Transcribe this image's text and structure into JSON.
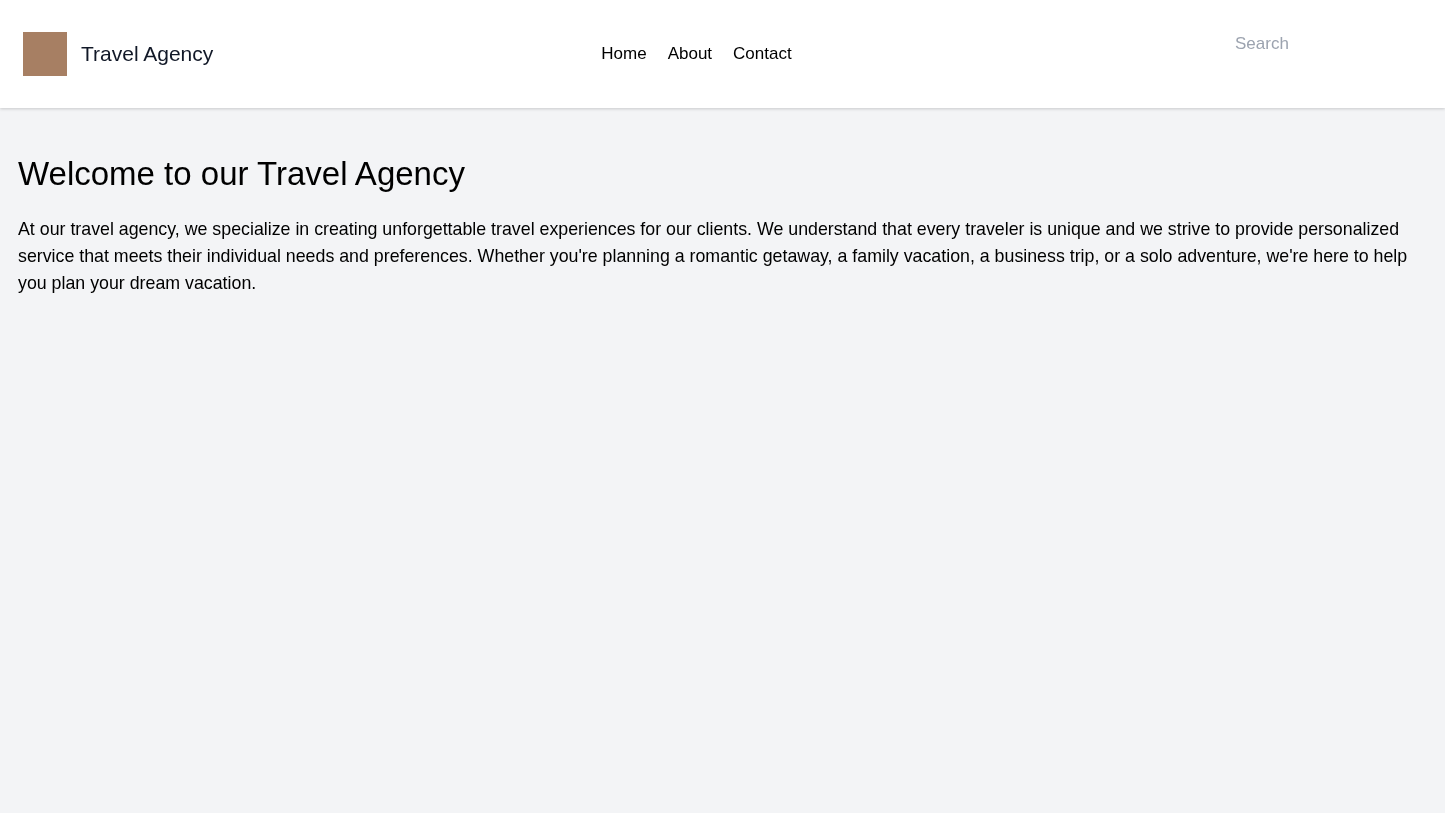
{
  "header": {
    "brand": {
      "name": "Travel Agency"
    },
    "nav": [
      {
        "label": "Home"
      },
      {
        "label": "About"
      },
      {
        "label": "Contact"
      }
    ],
    "search": {
      "placeholder": "Search"
    }
  },
  "main": {
    "heading": "Welcome to our Travel Agency",
    "paragraph": "At our travel agency, we specialize in creating unforgettable travel experiences for our clients. We understand that every traveler is unique and we strive to provide personalized service that meets their individual needs and preferences. Whether you're planning a romantic getaway, a family vacation, a business trip, or a solo adventure, we're here to help you plan your dream vacation."
  }
}
